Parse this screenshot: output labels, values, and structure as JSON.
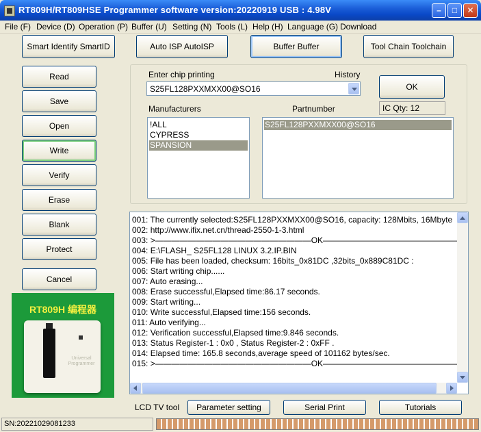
{
  "window": {
    "title": "RT809H/RT809HSE Programmer software version:20220919  USB : 4.98V",
    "minimize_glyph": "–",
    "maximize_glyph": "□",
    "close_glyph": "✕"
  },
  "menu": [
    "File (F)",
    "Device (D)",
    "Operation (P)",
    "Buffer (U)",
    "Setting (N)",
    "Tools (L)",
    "Help (H)",
    "Language (G)",
    "Download"
  ],
  "top_buttons": [
    "Smart Identify SmartID",
    "Auto ISP AutoISP",
    "Buffer Buffer",
    "Tool Chain Toolchain"
  ],
  "side_buttons": [
    "Read",
    "Save",
    "Open",
    "Write",
    "Verify",
    "Erase",
    "Blank",
    "Protect",
    "Cancel"
  ],
  "chip": {
    "enter_label": "Enter chip printing",
    "history_label": "History",
    "value": "S25FL128PXXMXX00@SO16",
    "ok_label": "OK",
    "ic_qty": "IC Qty: 12"
  },
  "manufacturers": {
    "label": "Manufacturers",
    "items": [
      "!ALL",
      "CYPRESS",
      "SPANSION"
    ],
    "selected": "SPANSION"
  },
  "partnumber": {
    "label": "Partnumber",
    "items": [
      "S25FL128PXXMXX00@SO16"
    ],
    "selected": "S25FL128PXXMXX00@SO16"
  },
  "log": [
    "001:  The currently selected:S25FL128PXXMXX00@SO16, capacity: 128Mbits, 16Mbyte",
    "002:  http://www.ifix.net.cn/thread-2550-1-3.html",
    "003:  >———————————————————OK———————————————————<",
    "004:  E:\\FLASH_ S25FL128  LINUX 3.2.IP.BIN",
    "005:  File has been loaded, checksum: 16bits_0x81DC ,32bits_0x889C81DC :",
    "006:  Start writing chip......",
    "007:  Auto erasing...",
    "008:  Erase successful,Elapsed time:86.17 seconds.",
    "009:  Start writing...",
    "010:  Write successful,Elapsed time:156 seconds.",
    "011:  Auto verifying...",
    "012:  Verification successful,Elapsed time:9.846 seconds.",
    "013:  Status Register-1 : 0x0 , Status Register-2 : 0xFF .",
    "014:  Elapsed time: 165.8 seconds,average speed of 101162 bytes/sec.",
    "015:  >———————————————————OK———————————————————<"
  ],
  "bottom": {
    "lcd_label": "LCD TV tool",
    "buttons": [
      "Parameter setting",
      "Serial Print",
      "Tutorials"
    ]
  },
  "photo_caption": "RT809H 编程器",
  "device_lettering": "Universal Programmer",
  "status": {
    "sn": "SN:20221029081233",
    "progress": 1.0,
    "progress_color": "#d59a6a"
  },
  "colors": {
    "titlebar": "#0a49c8",
    "selection": "#9a9a8a",
    "photo_bg": "#1c9a3a"
  }
}
